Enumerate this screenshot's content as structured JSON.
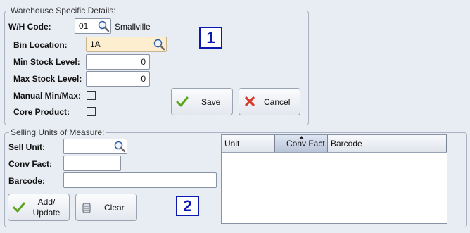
{
  "warehouse": {
    "legend": "Warehouse Specific Details:",
    "wh_code_label": "W/H Code:",
    "wh_code_value": "01",
    "wh_name": "Smallville",
    "bin_location_label": "Bin Location:",
    "bin_location_value": "1A",
    "min_stock_label": "Min Stock Level:",
    "min_stock_value": "0",
    "max_stock_label": "Max Stock Level:",
    "max_stock_value": "0",
    "manual_minmax_label": "Manual Min/Max:",
    "core_product_label": "Core Product:",
    "save_label": "Save",
    "cancel_label": "Cancel",
    "badge": "1"
  },
  "selling": {
    "legend": "Selling Units of Measure:",
    "sell_unit_label": "Sell Unit:",
    "sell_unit_value": "",
    "conv_fact_label": "Conv Fact:",
    "conv_fact_value": "",
    "barcode_label": "Barcode:",
    "barcode_value": "",
    "add_update_label_1": "Add/",
    "add_update_label_2": "Update",
    "clear_label": "Clear",
    "badge": "2",
    "grid_columns": [
      "Unit",
      "Conv Fact",
      "Barcode"
    ]
  },
  "colors": {
    "accent_badge": "#0a1ab0",
    "highlight_input": "#fdeed0",
    "save_check": "#5aa31a",
    "cancel_x": "#d83a2a"
  }
}
